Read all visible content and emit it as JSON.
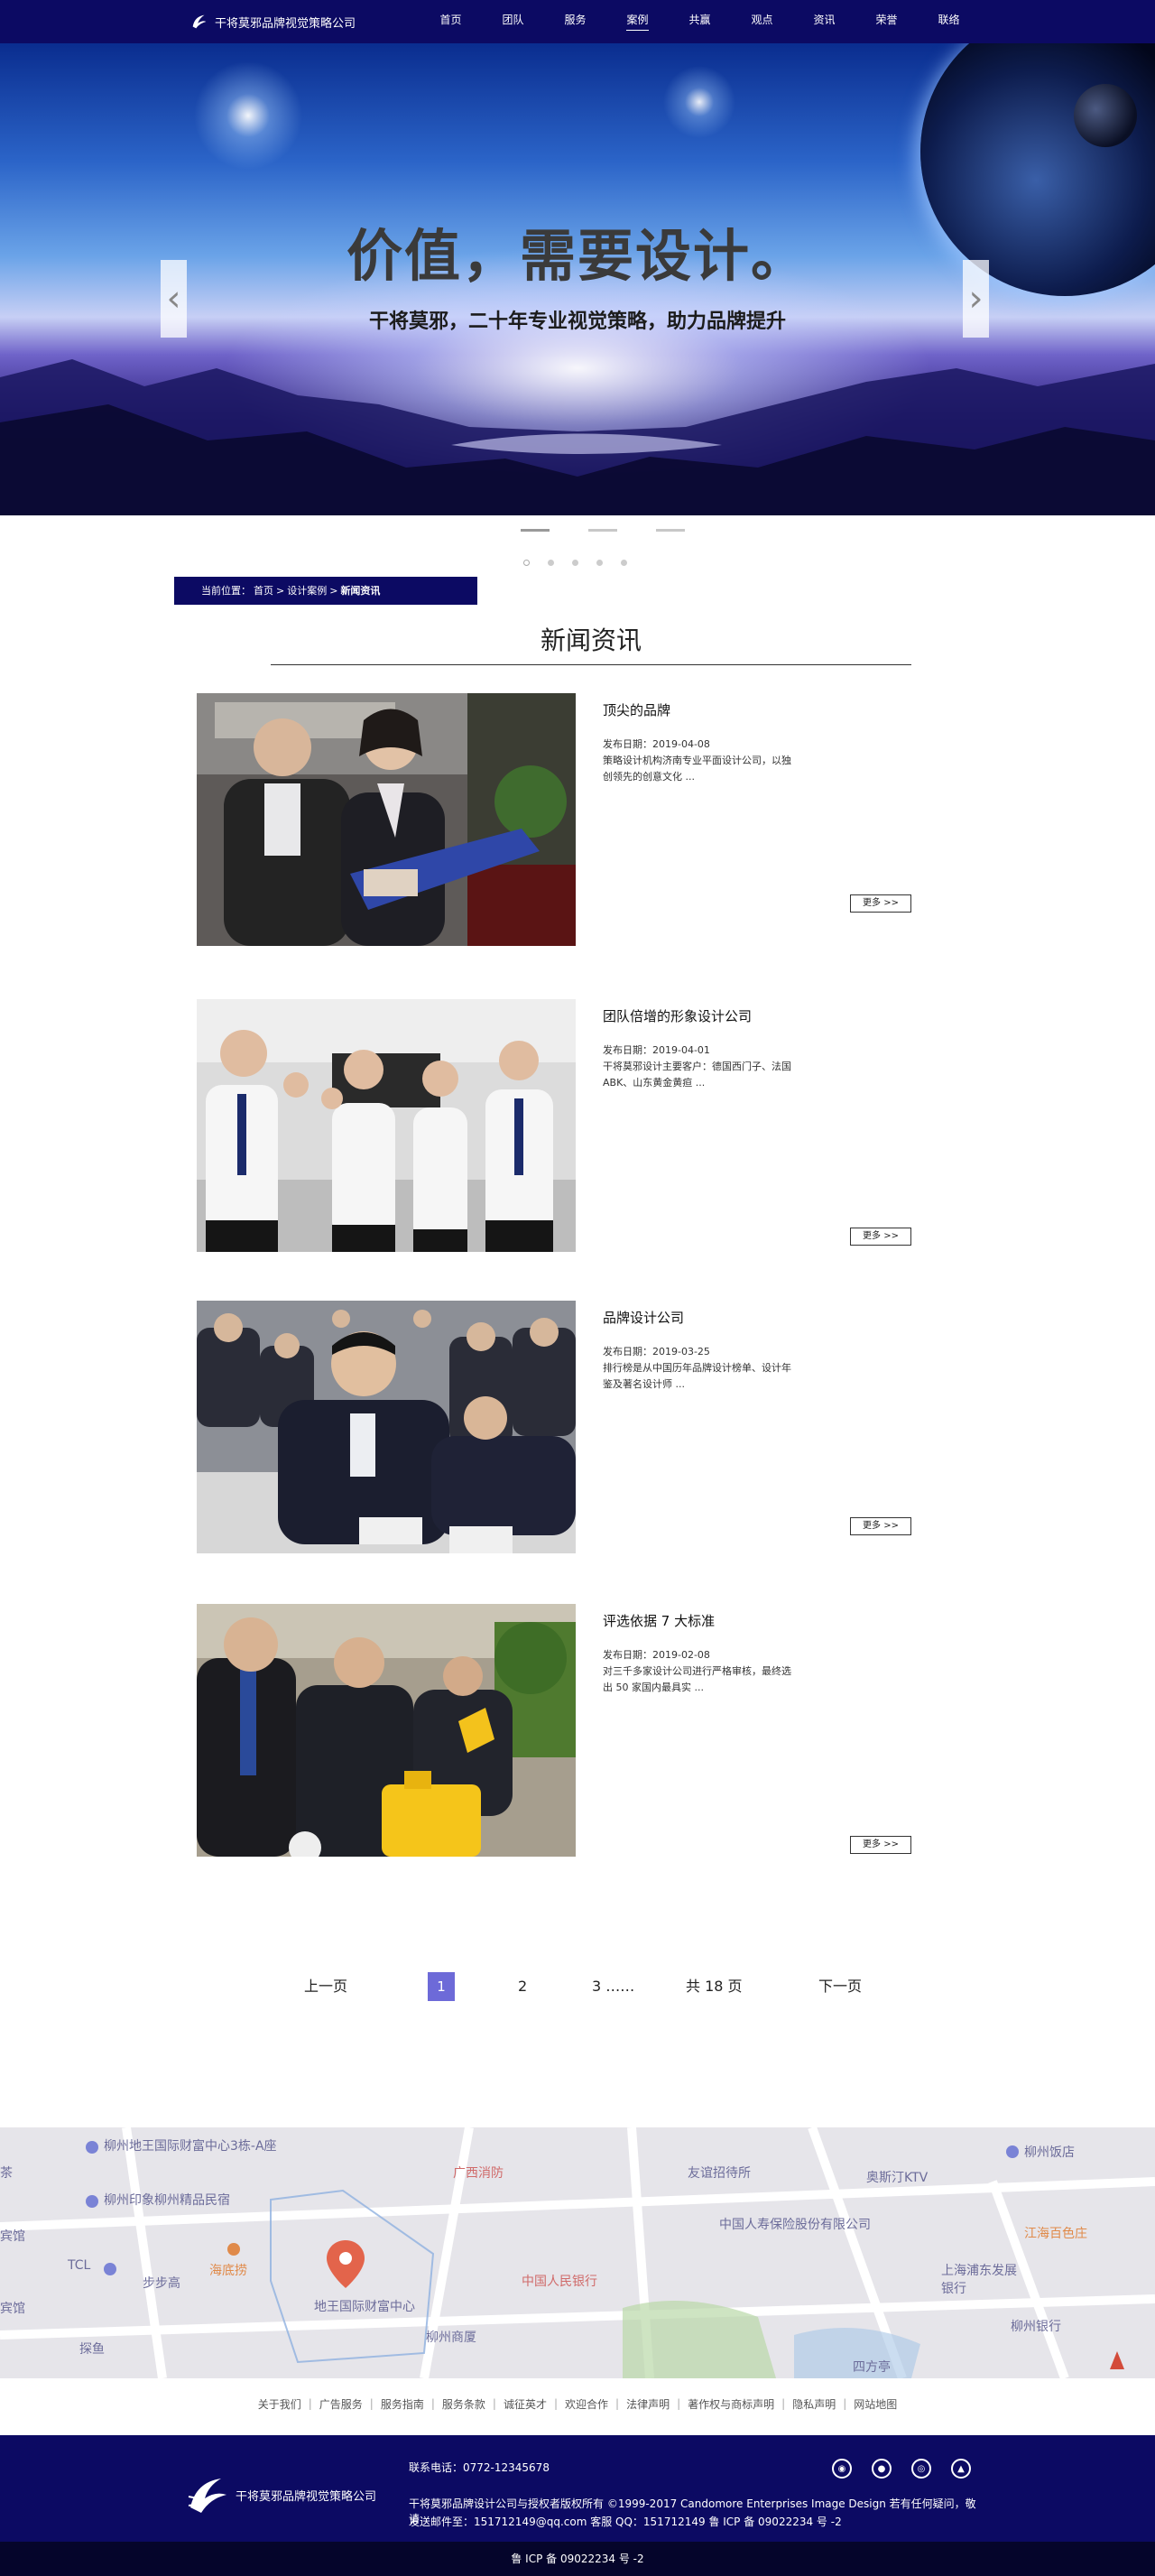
{
  "header": {
    "logo_text": "干将莫邪品牌视觉策略公司",
    "nav": [
      "首页",
      "团队",
      "服务",
      "案例",
      "共赢",
      "观点",
      "资讯",
      "荣誉",
      "联络"
    ],
    "active_nav": "案例"
  },
  "hero": {
    "title": "价值，需要设计。",
    "subtitle": "干将莫邪，二十年专业视觉策略，助力品牌提升",
    "prev_glyph": "‹",
    "next_glyph": "›"
  },
  "breadcrumb": {
    "prefix": "当前位置：",
    "home": "首页",
    "sep": ">",
    "category": "设计案例",
    "current": "新闻资讯"
  },
  "section": {
    "title": "新闻资讯"
  },
  "news": [
    {
      "title": "顶尖的品牌",
      "date": "发布日期：2019-04-08",
      "desc": "策略设计机构济南专业平面设计公司，以独创领先的创意文化 ...",
      "more": "更多 >>"
    },
    {
      "title": "团队倍增的形象设计公司",
      "date": "发布日期：2019-04-01",
      "desc": "干将莫邪设计主要客户：德国西门子、法国ABK、山东黄金黄疸 ...",
      "more": "更多 >>"
    },
    {
      "title": "品牌设计公司",
      "date": "发布日期：2019-03-25",
      "desc": "排行榜是从中国历年品牌设计榜单、设计年鉴及著名设计师 ...",
      "more": "更多 >>"
    },
    {
      "title": "评选依据 7 大标准",
      "date": "发布日期：2019-02-08",
      "desc": "对三千多家设计公司进行严格审核，最终选出 50 家国内最具实 ...",
      "more": "更多 >>"
    }
  ],
  "pagination": {
    "prev": "上一页",
    "pages": [
      "1",
      "2",
      "3 ……"
    ],
    "current": "1",
    "total": "共 18 页",
    "next": "下一页"
  },
  "map": {
    "labels": [
      "柳州地王国际财富中心3栋-A座",
      "柳州印象柳州精品民宿",
      "TCL",
      "步步高",
      "海底捞",
      "地王国际财富中心",
      "柳州商厦",
      "广西消防",
      "友谊招待所",
      "中国人寿保险股份有限公司",
      "中国人民银行",
      "奥斯汀KTV",
      "柳州饭店",
      "江海百色庄",
      "上海浦东发展银行",
      "柳州银行",
      "四方亭",
      "宾馆",
      "探鱼",
      "茶",
      "宾馆"
    ]
  },
  "footer_links": [
    "关于我们",
    "广告服务",
    "服务指南",
    "服务条款",
    "诚征英才",
    "欢迎合作",
    "法律声明",
    "著作权与商标声明",
    "隐私声明",
    "网站地图"
  ],
  "footer": {
    "logo_text": "干将莫邪品牌视觉策略公司",
    "phone": "联系电话：0772-12345678",
    "copyright": "干将莫邪品牌设计公司与授权者版权所有 ©1999-2017 Candomore Enterprises Image Design 若有任何疑问，敬请",
    "contact": "发送邮件至：151712149@qq.com 客服 QQ：151712149 鲁 ICP 备 09022234 号 -2",
    "icons": [
      "weibo-icon",
      "wechat-icon",
      "qq-icon",
      "bell-icon"
    ],
    "icp": "鲁 ICP 备 09022234 号 -2"
  },
  "colors": {
    "brand_navy": "#0c0a63",
    "page_current": "#6d6ad8"
  }
}
